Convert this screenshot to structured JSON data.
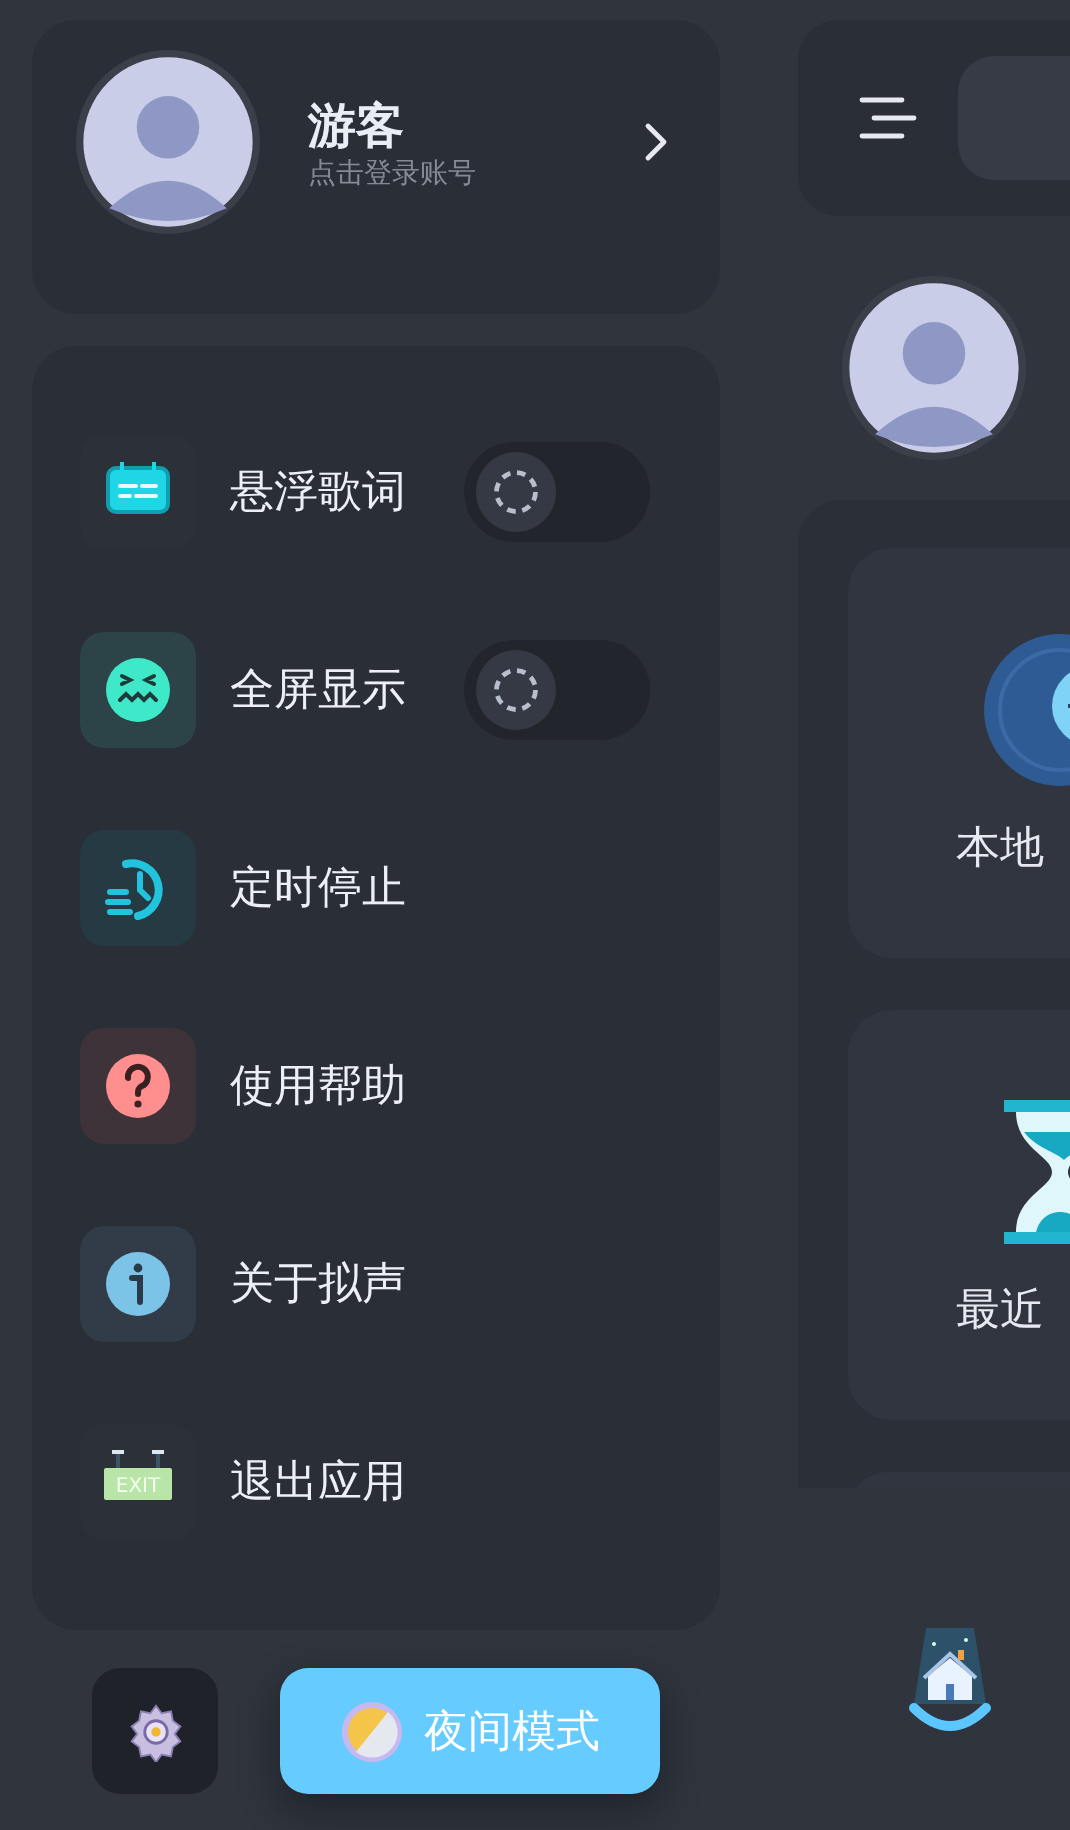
{
  "profile": {
    "name": "游客",
    "subtitle": "点击登录账号"
  },
  "menu": [
    {
      "kind": "toggle",
      "label": "悬浮歌词",
      "on": false
    },
    {
      "kind": "toggle",
      "label": "全屏显示",
      "on": false
    },
    {
      "kind": "link",
      "label": "定时停止"
    },
    {
      "kind": "link",
      "label": "使用帮助"
    },
    {
      "kind": "link",
      "label": "关于拟声"
    },
    {
      "kind": "link",
      "label": "退出应用",
      "sign_text": "EXIT"
    }
  ],
  "night_mode_button": {
    "label": "夜间模式"
  },
  "main": {
    "cards": [
      {
        "label": "本地"
      },
      {
        "label": "最近"
      }
    ]
  }
}
